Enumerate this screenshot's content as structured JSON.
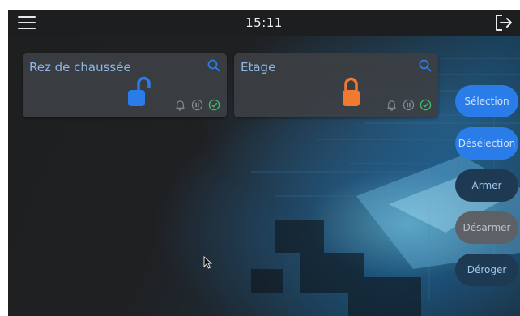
{
  "topbar": {
    "clock": "15:11",
    "menu_icon": "hamburger-menu-icon",
    "logout_icon": "logout-icon"
  },
  "zones": [
    {
      "title": "Rez de chaussée",
      "lock_state": "unlocked",
      "lock_color": "#2a7de8",
      "status_icons": [
        "bell-icon",
        "pause-icon",
        "check-circle-icon"
      ]
    },
    {
      "title": "Etage",
      "lock_state": "locked",
      "lock_color": "#f07a32",
      "status_icons": [
        "bell-icon",
        "pause-icon",
        "check-circle-icon"
      ]
    }
  ],
  "actions": {
    "selection": "Sélection",
    "deselection": "Désélection",
    "armer": "Armer",
    "desarmer": "Désarmer",
    "deroger": "Déroger"
  },
  "colors": {
    "accent_blue": "#2a7de8",
    "lock_orange": "#f07a32",
    "title_blue": "#8fb6e6",
    "check_green": "#3fbf6b"
  }
}
